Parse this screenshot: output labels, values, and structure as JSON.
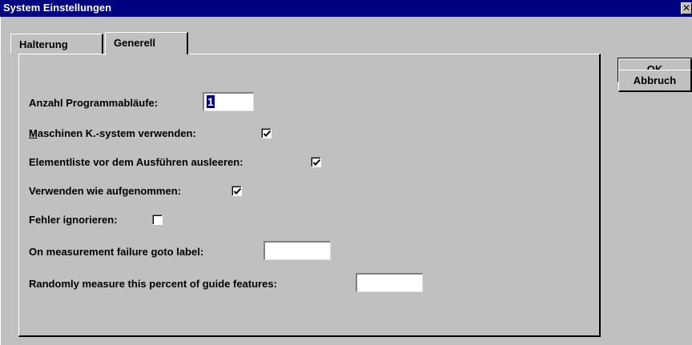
{
  "window": {
    "title": "System Einstellungen",
    "close_glyph": "✕"
  },
  "tabs": [
    {
      "label": "Halterung",
      "selected": false
    },
    {
      "label": "Generell",
      "selected": true
    }
  ],
  "buttons": {
    "ok_label": "OK",
    "cancel_label": "Abbruch"
  },
  "form": {
    "program_runs": {
      "label": "Anzahl Programmabläufe:",
      "value": "1"
    },
    "machine_cs": {
      "label_ul": "M",
      "label_rest": "aschinen K.-system verwenden:",
      "checked": true
    },
    "clear_elements": {
      "label": "Elementliste vor dem Ausführen ausleeren:",
      "checked": true
    },
    "use_as_recorded": {
      "label": "Verwenden wie aufgenommen:",
      "checked": true
    },
    "ignore_errors": {
      "label": "Fehler ignorieren:",
      "checked": false
    },
    "failure_goto": {
      "label": "On measurement failure goto label:",
      "value": ""
    },
    "random_measure": {
      "label": "Randomly measure this percent of guide features:",
      "value": ""
    }
  },
  "colors": {
    "titlebar": "#000080",
    "face": "#c0c0c0",
    "selection": "#000080"
  }
}
